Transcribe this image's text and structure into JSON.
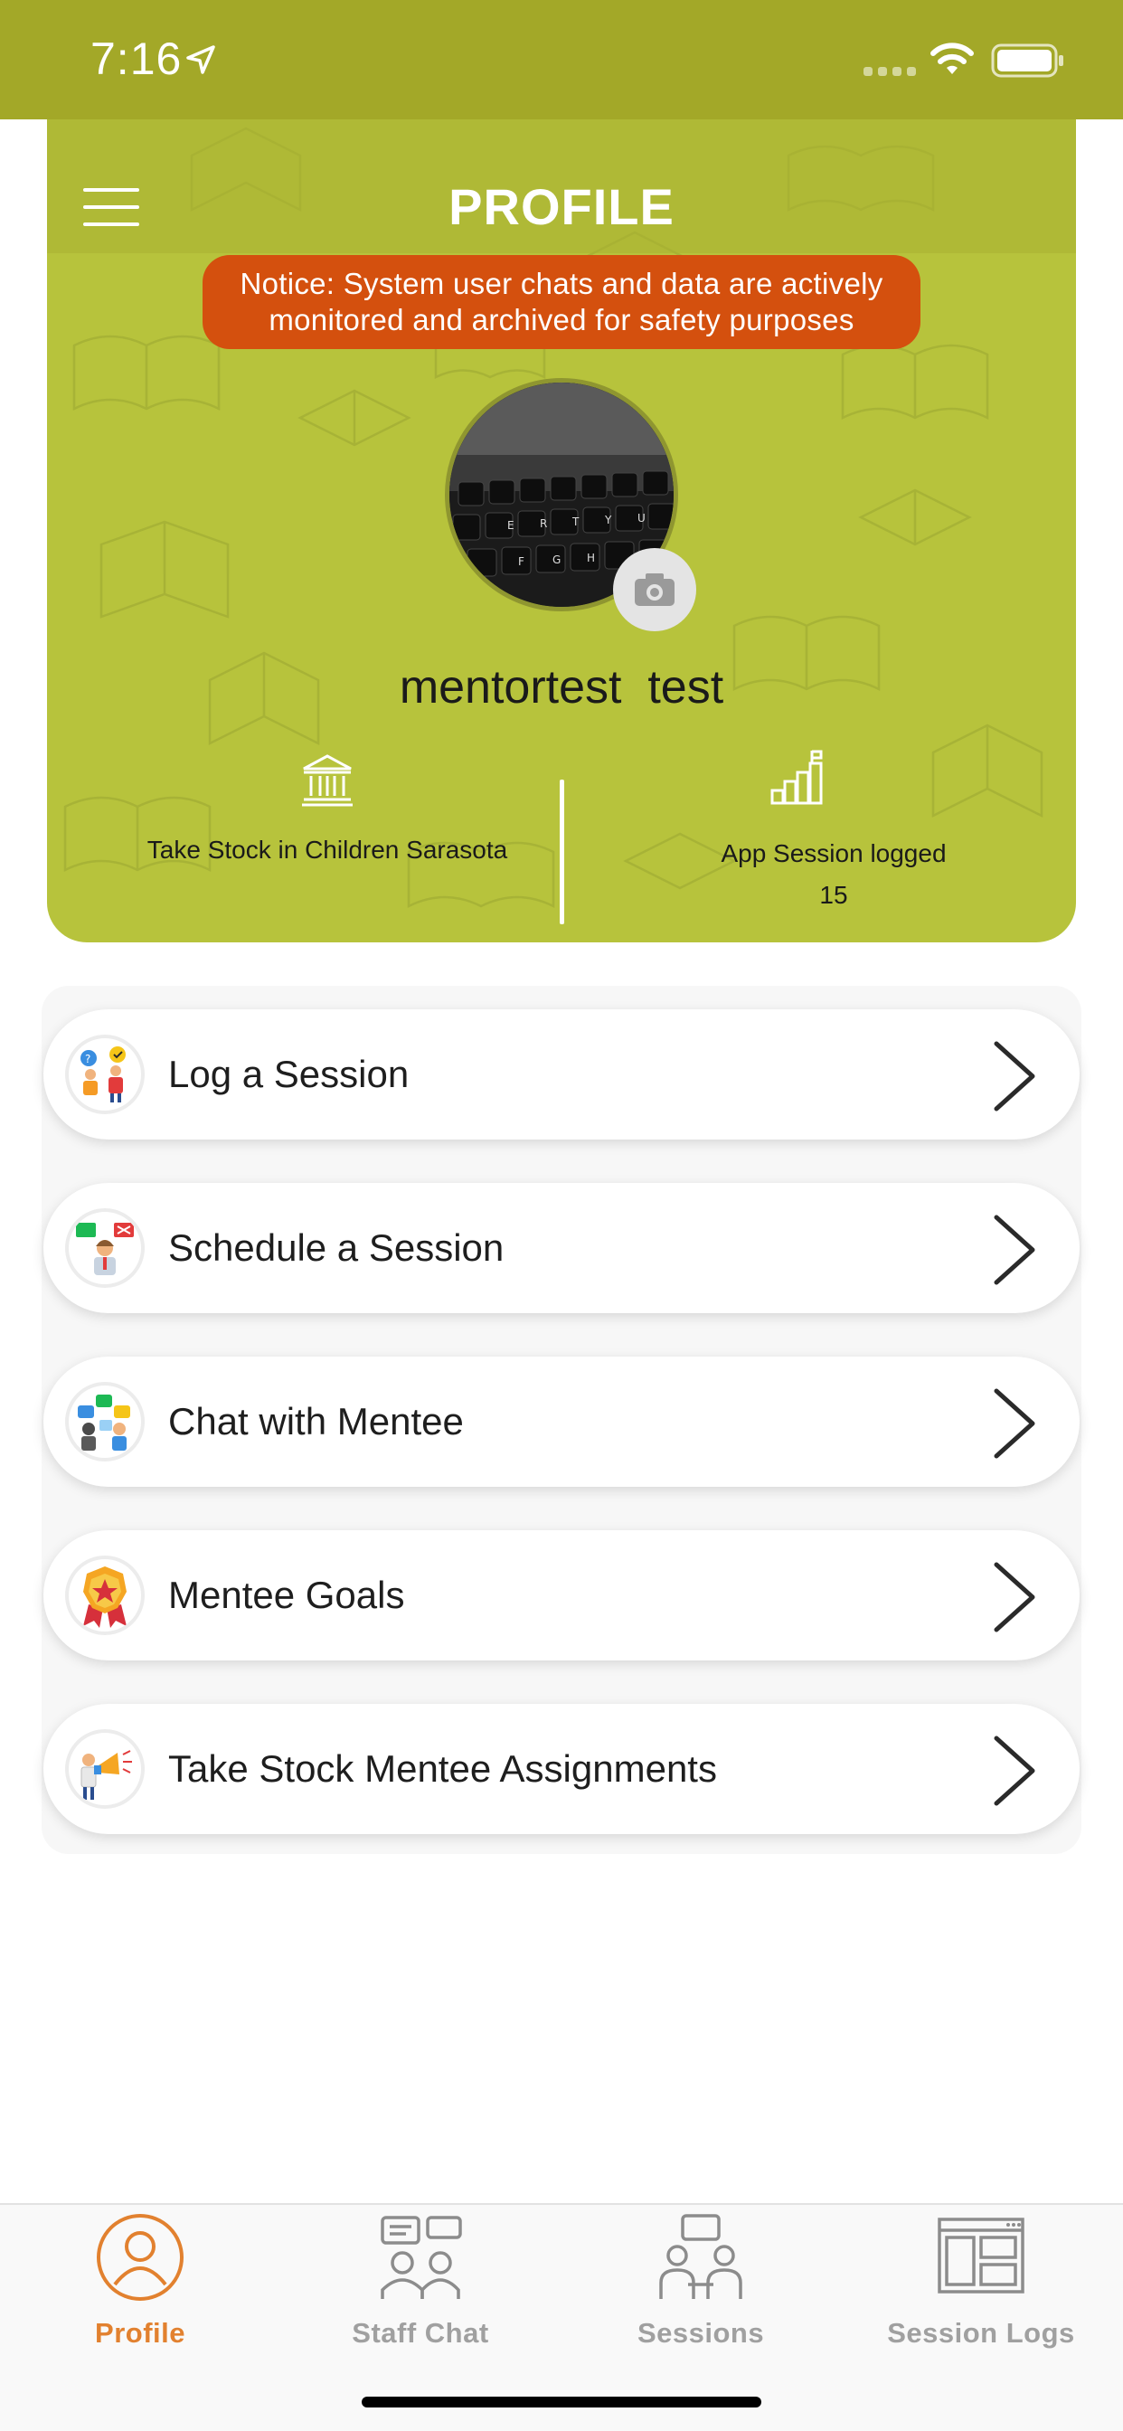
{
  "status_bar": {
    "time": "7:16",
    "icons": [
      "location-arrow-icon",
      "signal-icon",
      "wifi-icon",
      "battery-icon"
    ]
  },
  "header": {
    "title": "PROFILE",
    "menu_icon": "hamburger-menu-icon",
    "notice": "Notice: System user chats and data are actively monitored and archived for safety purposes",
    "user_name": "mentortest  test",
    "organization": "Take Stock in Children Sarasota",
    "sessions_label": "App Session logged",
    "sessions_value": "15",
    "colors": {
      "header_bg": "#b7c33c",
      "status_bar_bg": "#a3a828",
      "notice_bg": "#d4500e"
    }
  },
  "menu": {
    "items": [
      {
        "label": "Log a Session",
        "icon": "log-session-icon"
      },
      {
        "label": "Schedule a Session",
        "icon": "schedule-session-icon"
      },
      {
        "label": "Chat with Mentee",
        "icon": "chat-mentee-icon"
      },
      {
        "label": "Mentee Goals",
        "icon": "goals-badge-icon"
      },
      {
        "label": "Take Stock Mentee Assignments",
        "icon": "assignments-megaphone-icon"
      }
    ]
  },
  "tab_bar": {
    "active": "Profile",
    "active_color": "#e2812f",
    "tabs": [
      {
        "label": "Profile",
        "icon": "profile-icon"
      },
      {
        "label": "Staff Chat",
        "icon": "staff-chat-icon"
      },
      {
        "label": "Sessions",
        "icon": "sessions-icon"
      },
      {
        "label": "Session Logs",
        "icon": "session-logs-icon"
      }
    ]
  }
}
